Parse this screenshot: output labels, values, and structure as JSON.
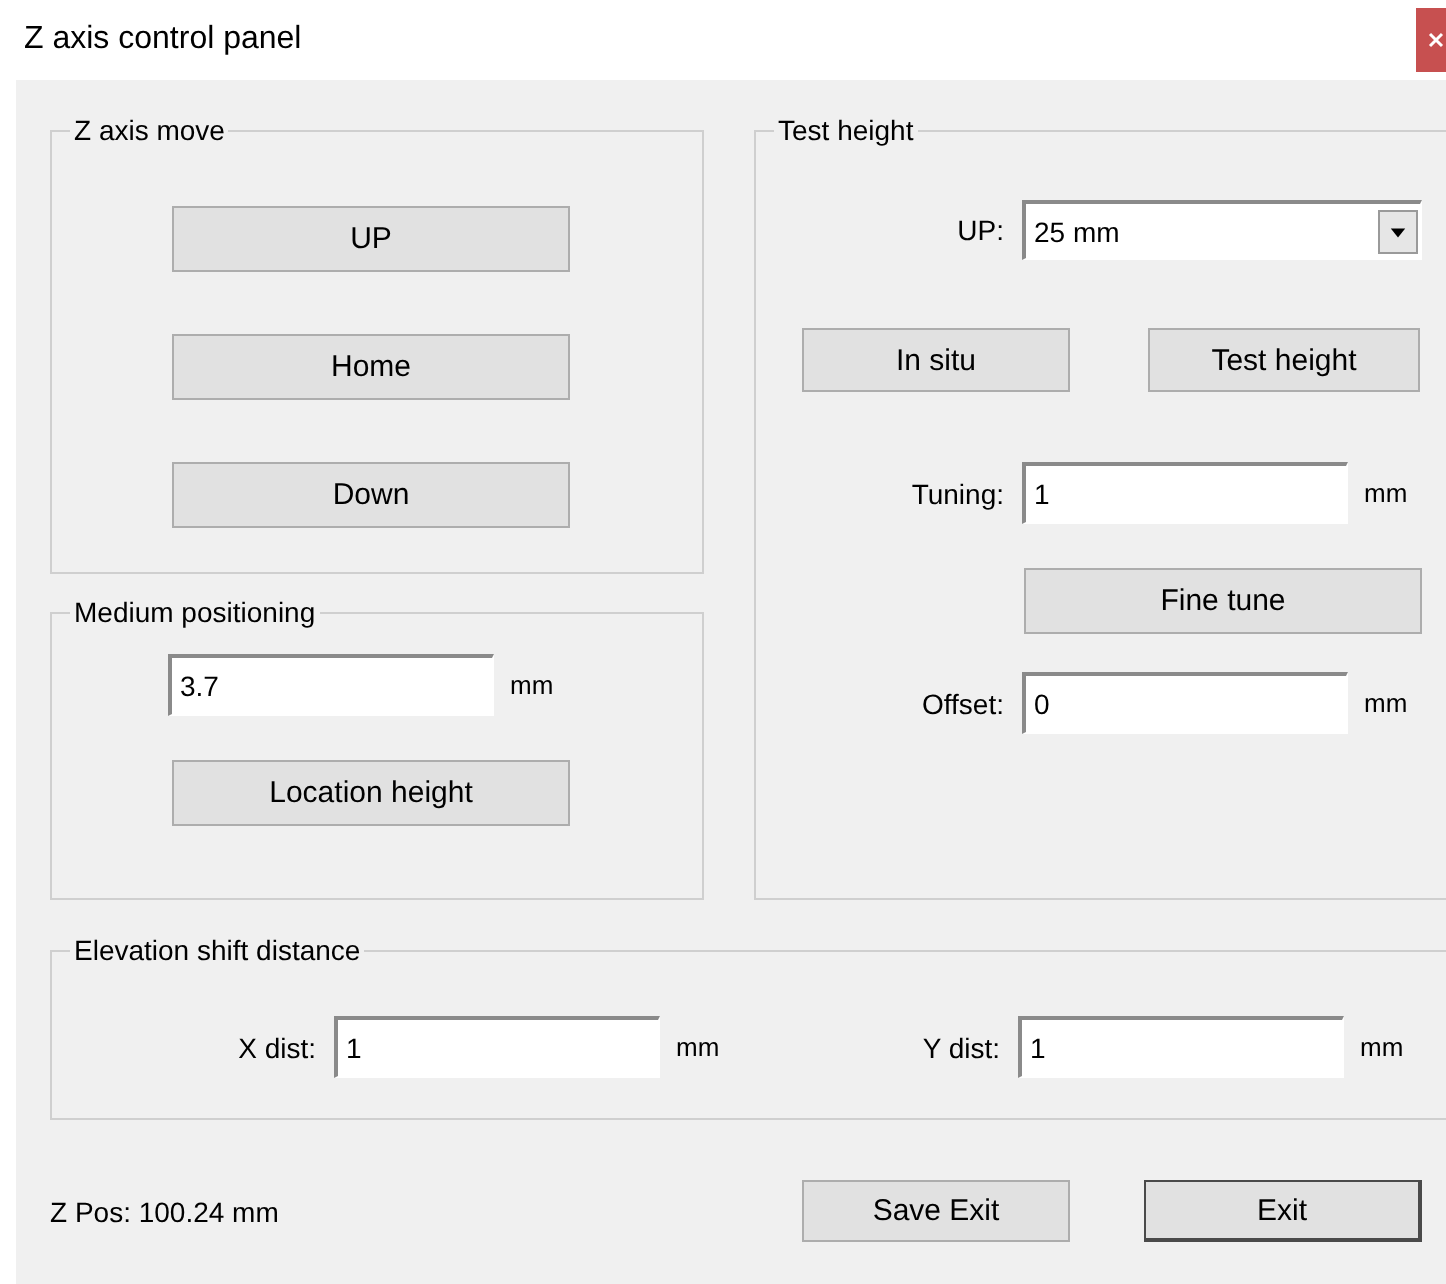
{
  "window": {
    "title": "Z axis control panel"
  },
  "z_axis_move": {
    "title": "Z axis move",
    "buttons": [
      "UP",
      "Home",
      "Down"
    ]
  },
  "medium_positioning": {
    "title": "Medium positioning",
    "value": "3.7",
    "unit": "mm",
    "button": "Location height"
  },
  "test_height": {
    "title": "Test height",
    "up": {
      "label": "UP:",
      "value": "25 mm"
    },
    "buttons": [
      "In situ",
      "Test height"
    ],
    "tuning": {
      "label": "Tuning:",
      "value": "1",
      "unit": "mm"
    },
    "fine_tune_button": "Fine tune",
    "offset": {
      "label": "Offset:",
      "value": "0",
      "unit": "mm"
    }
  },
  "elevation_shift": {
    "title": "Elevation shift distance",
    "fields": [
      {
        "label": "X dist:",
        "value": "1",
        "unit": "mm"
      },
      {
        "label": "Y dist:",
        "value": "1",
        "unit": "mm"
      }
    ]
  },
  "status": {
    "z_pos": "Z Pos: 100.24 mm"
  },
  "buttons": [
    {
      "label": "Save Exit",
      "default": false
    },
    {
      "label": "Exit",
      "default": true
    }
  ]
}
